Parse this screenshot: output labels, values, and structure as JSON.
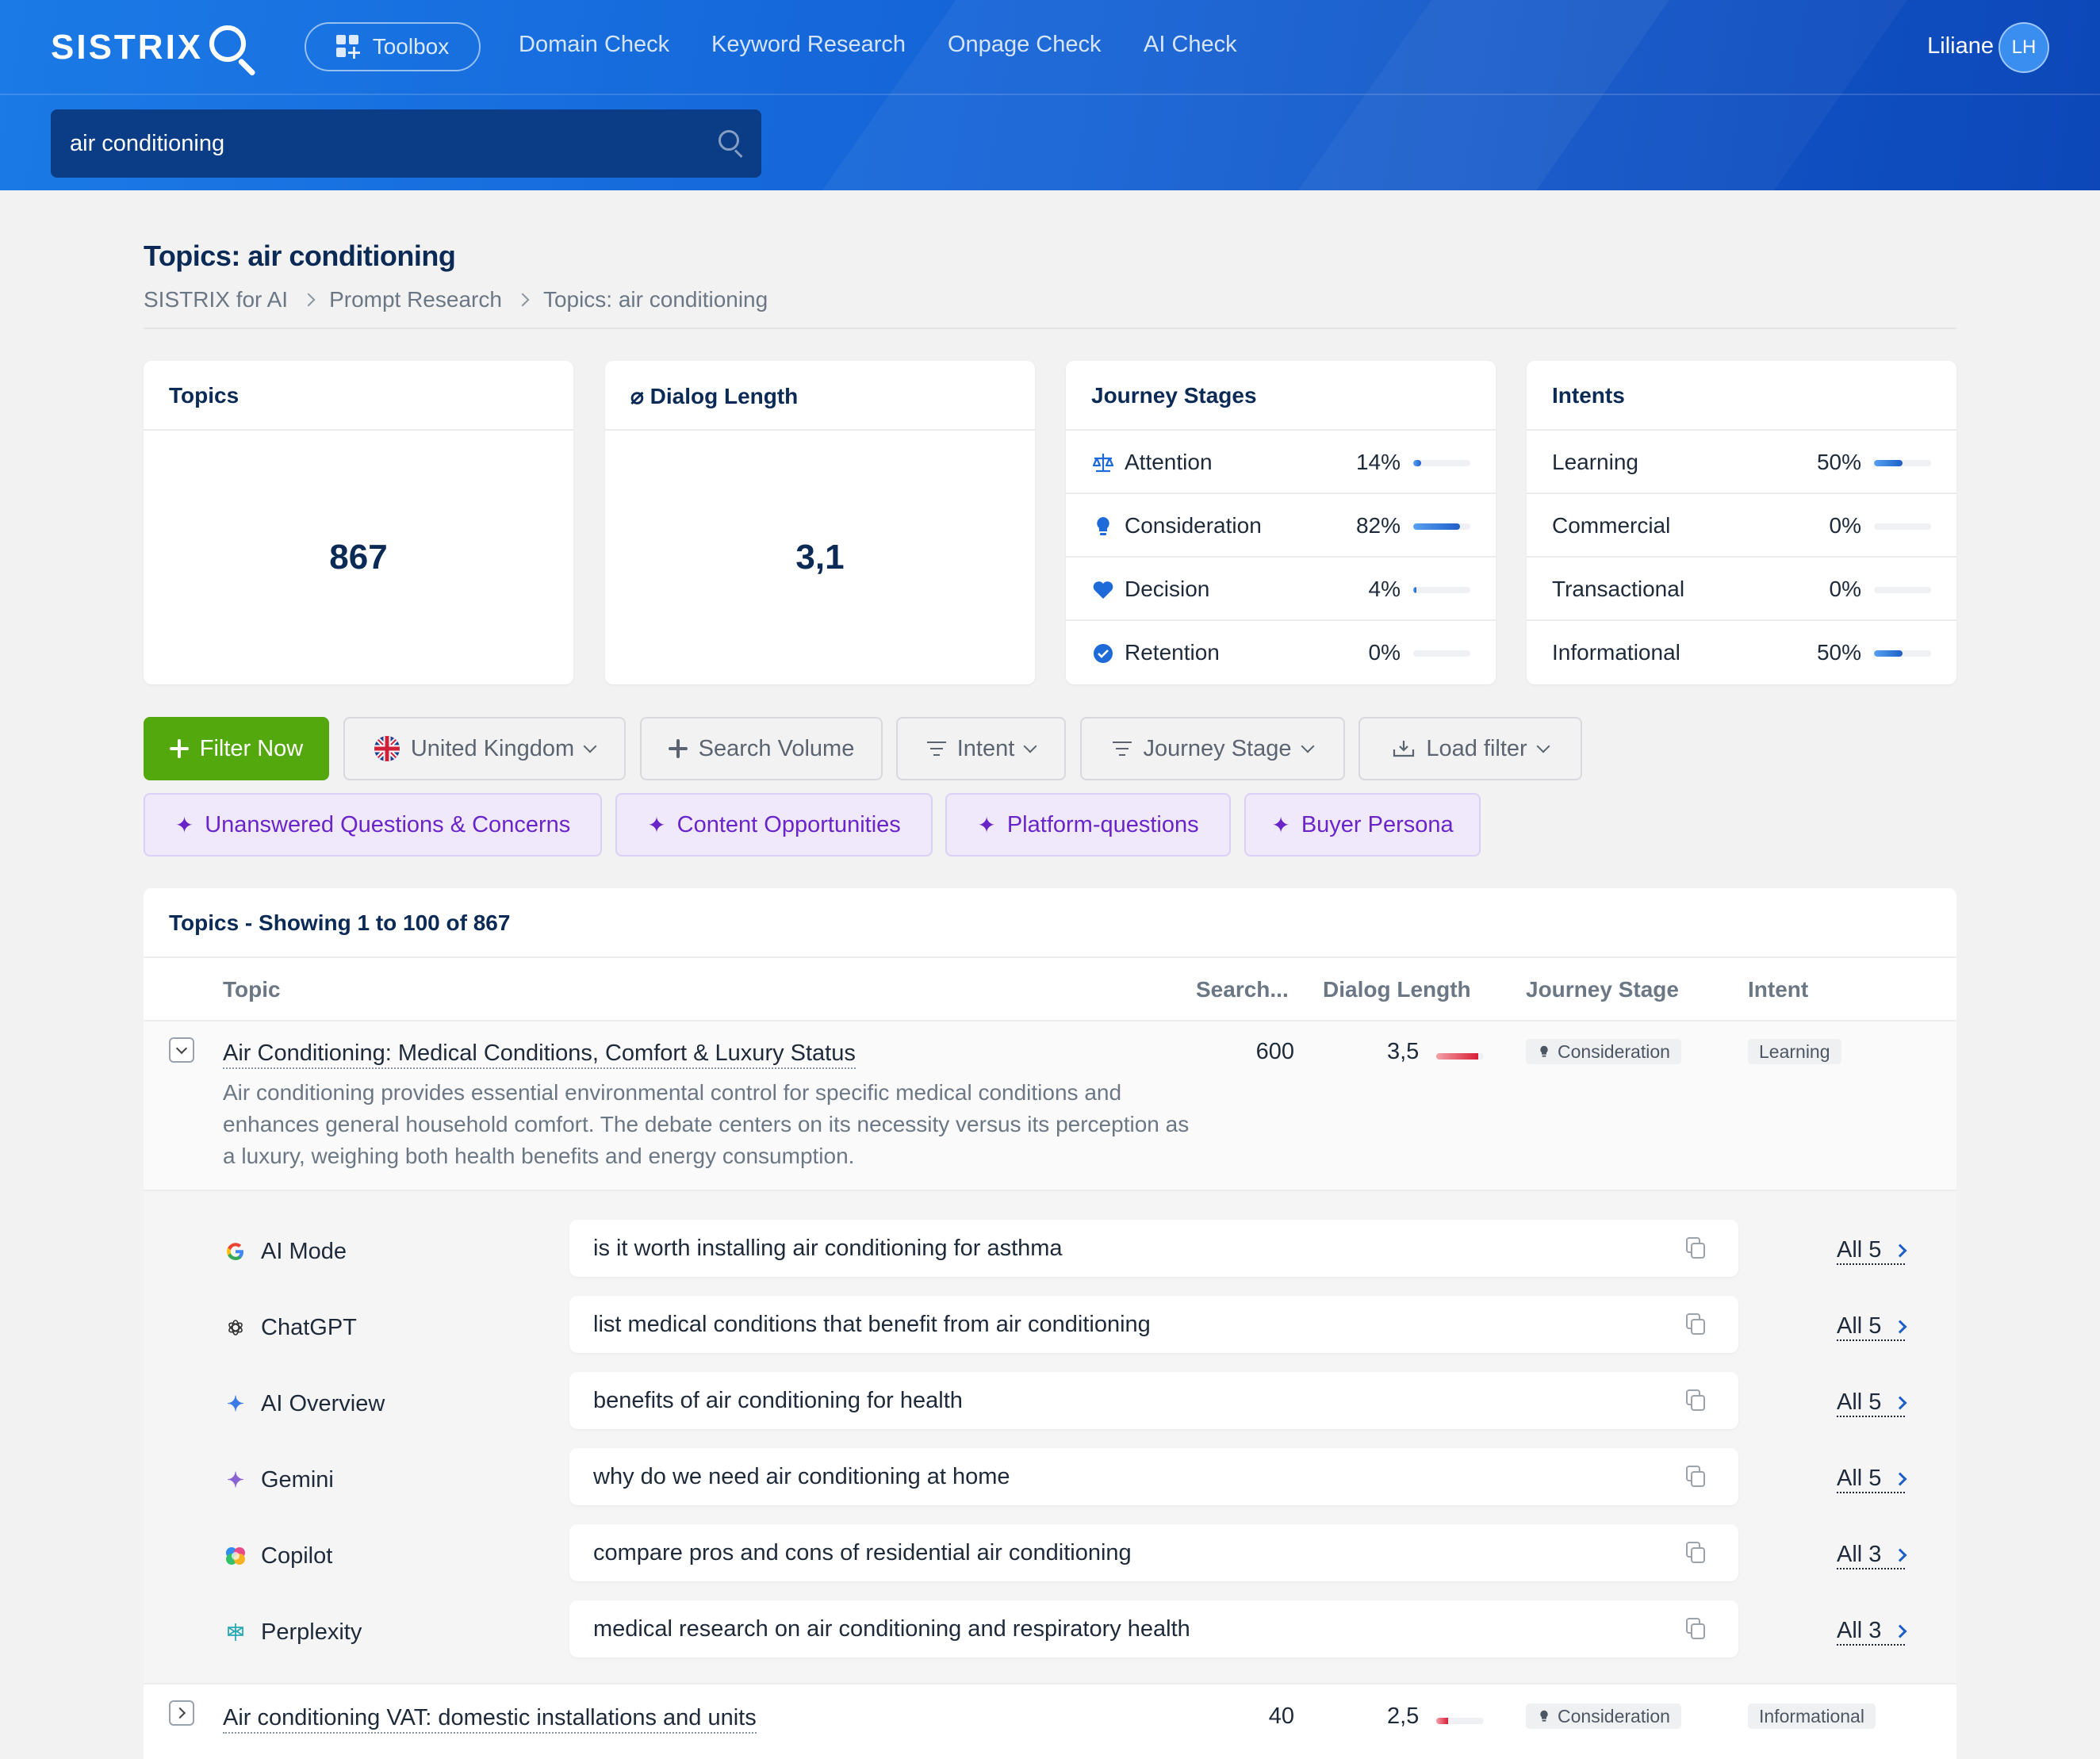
{
  "header": {
    "logo": "SISTRIX",
    "toolbox": "Toolbox",
    "nav": [
      "Domain Check",
      "Keyword Research",
      "Onpage Check",
      "AI Check"
    ],
    "user_name": "Liliane",
    "avatar_initials": "LH",
    "search_value": "air conditioning"
  },
  "page": {
    "title": "Topics: air conditioning",
    "breadcrumb": [
      "SISTRIX for AI",
      "Prompt Research",
      "Topics: air conditioning"
    ]
  },
  "cards": {
    "topics": {
      "title": "Topics",
      "value": "867"
    },
    "dialog": {
      "title": "⌀ Dialog Length",
      "value": "3,1"
    },
    "journey": {
      "title": "Journey Stages",
      "rows": [
        {
          "label": "Attention",
          "pct": "14%",
          "fill": 0.14,
          "icon": "scale-icon"
        },
        {
          "label": "Consideration",
          "pct": "82%",
          "fill": 0.82,
          "icon": "lightbulb-icon"
        },
        {
          "label": "Decision",
          "pct": "4%",
          "fill": 0.04,
          "icon": "heart-icon"
        },
        {
          "label": "Retention",
          "pct": "0%",
          "fill": 0.0,
          "icon": "check-circle-icon"
        }
      ]
    },
    "intents": {
      "title": "Intents",
      "rows": [
        {
          "label": "Learning",
          "pct": "50%",
          "fill": 0.5
        },
        {
          "label": "Commercial",
          "pct": "0%",
          "fill": 0.0
        },
        {
          "label": "Transactional",
          "pct": "0%",
          "fill": 0.0
        },
        {
          "label": "Informational",
          "pct": "50%",
          "fill": 0.5
        }
      ]
    }
  },
  "filters": {
    "filter_now": "Filter Now",
    "country": "United Kingdom",
    "search_volume": "Search Volume",
    "intent": "Intent",
    "journey_stage": "Journey Stage",
    "load_filter": "Load filter",
    "ai_chips": [
      "Unanswered Questions & Concerns",
      "Content Opportunities",
      "Platform-questions",
      "Buyer Persona"
    ]
  },
  "table": {
    "title": "Topics - Showing 1 to 100 of 867",
    "columns": [
      "Topic",
      "Search...",
      "Dialog Length",
      "Journey Stage",
      "Intent"
    ],
    "rows": [
      {
        "title": "Air Conditioning: Medical Conditions, Comfort & Luxury Status",
        "description": "Air conditioning provides essential environmental control for specific medical conditions and enhances general household comfort. The debate centers on its necessity versus its perception as a luxury, weighing both health benefits and energy consumption.",
        "search_volume": "600",
        "dialog_length": "3,5",
        "dialog_fill": 0.88,
        "journey_stage": "Consideration",
        "intent": "Learning",
        "prompts": [
          {
            "platform": "AI Mode",
            "prompt": "is it worth installing air conditioning for asthma",
            "all": "All 5"
          },
          {
            "platform": "ChatGPT",
            "prompt": "list medical conditions that benefit from air conditioning",
            "all": "All 5"
          },
          {
            "platform": "AI Overview",
            "prompt": "benefits of air conditioning for health",
            "all": "All 5"
          },
          {
            "platform": "Gemini",
            "prompt": "why do we need air conditioning at home",
            "all": "All 5"
          },
          {
            "platform": "Copilot",
            "prompt": "compare pros and cons of residential air conditioning",
            "all": "All 3"
          },
          {
            "platform": "Perplexity",
            "prompt": "medical research on air conditioning and respiratory health",
            "all": "All 3"
          }
        ]
      },
      {
        "title": "Air conditioning VAT: domestic installations and units",
        "search_volume": "40",
        "dialog_length": "2,5",
        "dialog_fill": 0.25,
        "journey_stage": "Consideration",
        "intent": "Informational"
      }
    ]
  },
  "colors": {
    "accent": "#1565d8",
    "green": "#52a80d",
    "purple": "#6a25c9"
  }
}
